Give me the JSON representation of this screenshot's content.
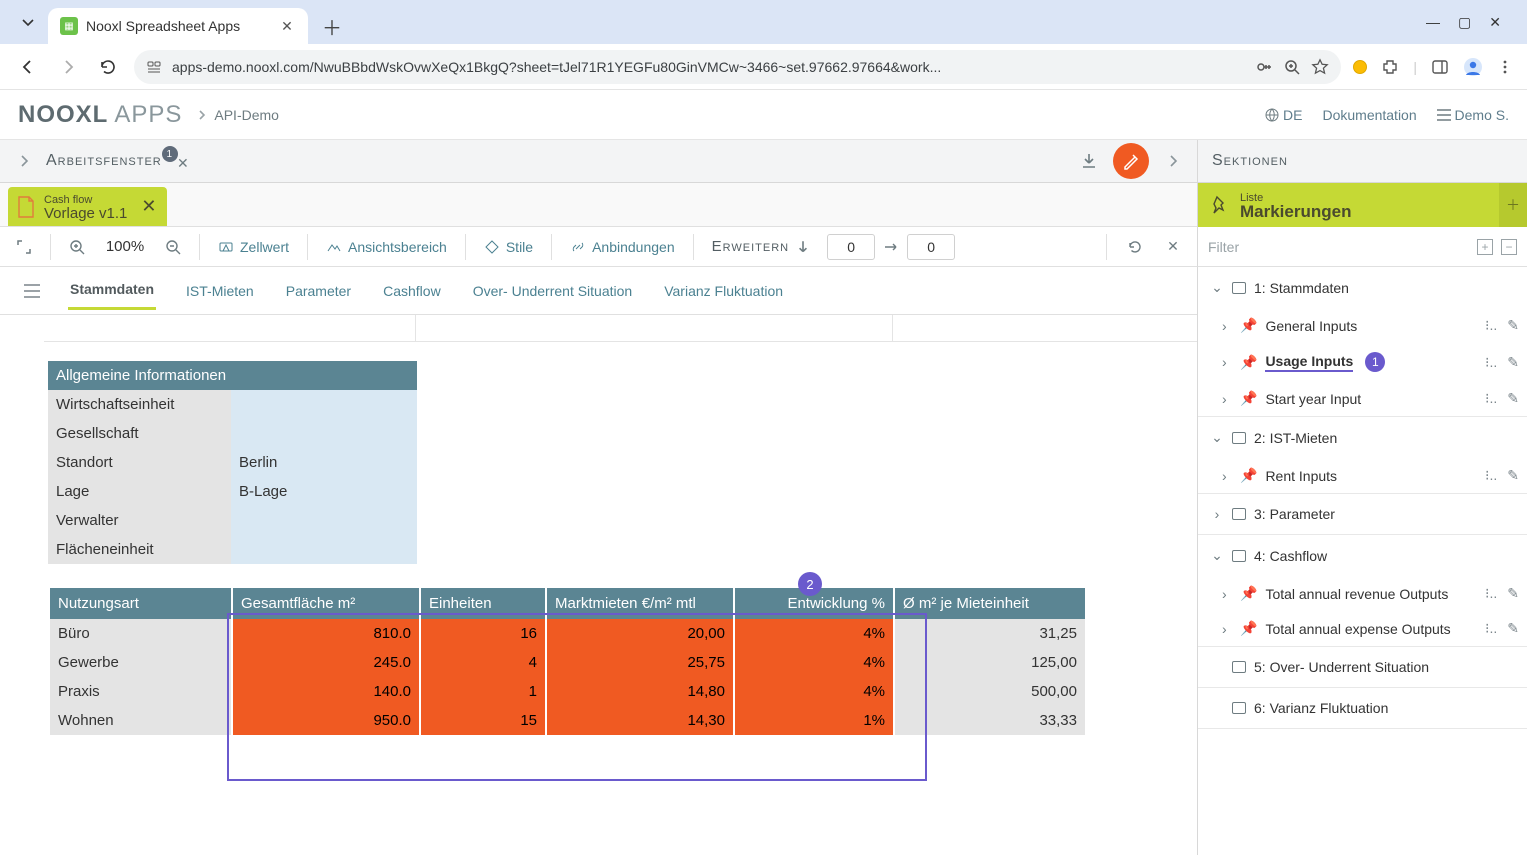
{
  "browser": {
    "tab_title": "Nooxl Spreadsheet Apps",
    "url": "apps-demo.nooxl.com/NwuBBbdWskOvwXeQx1BkgQ?sheet=tJel71R1YEGFu80GinVMCw~3466~set.97662.97664&work..."
  },
  "header": {
    "brand": "NOOXL",
    "brand_sub": "APPS",
    "crumb": "API-Demo",
    "lang": "DE",
    "docs": "Dokumentation",
    "user": "Demo S."
  },
  "toolbar1": {
    "title": "Arbeitsfenster",
    "badge": "1",
    "sektionen": "Sektionen"
  },
  "sheetTab": {
    "category": "Cash flow",
    "name": "Vorlage v1.1"
  },
  "markHeader": {
    "category": "Liste",
    "name": "Markierungen"
  },
  "toolbar2": {
    "zoom": "100%",
    "zellwert": "Zellwert",
    "ansicht": "Ansichtsbereich",
    "stile": "Stile",
    "anbindungen": "Anbindungen",
    "erweitern": "Erweitern",
    "n1": "0",
    "n2": "0",
    "filter": "Filter"
  },
  "sheetNav": {
    "tab1": "Stammdaten",
    "tab2": "IST-Mieten",
    "tab3": "Parameter",
    "tab4": "Cashflow",
    "tab5": "Over- Underrent Situation",
    "tab6": "Varianz Fluktuation"
  },
  "infoTable": {
    "header": "Allgemeine Informationen",
    "r1_l": "Wirtschaftseinheit",
    "r1_v": "",
    "r2_l": "Gesellschaft",
    "r2_v": "",
    "r3_l": "Standort",
    "r3_v": "Berlin",
    "r4_l": "Lage",
    "r4_v": "B-Lage",
    "r5_l": "Verwalter",
    "r5_v": "",
    "r6_l": "Flächeneinheit",
    "r6_v": ""
  },
  "usageTable": {
    "h1": "Nutzungsart",
    "h2": "Gesamtfläche m²",
    "h3": "Einheiten",
    "h4": "Marktmieten €/m² mtl",
    "h5": "Entwicklung %",
    "h6": "Ø m² je Mieteinheit",
    "r1": {
      "name": "Büro",
      "area": "810.0",
      "units": "16",
      "rent": "20,00",
      "dev": "4%",
      "avg": "31,25"
    },
    "r2": {
      "name": "Gewerbe",
      "area": "245.0",
      "units": "4",
      "rent": "25,75",
      "dev": "4%",
      "avg": "125,00"
    },
    "r3": {
      "name": "Praxis",
      "area": "140.0",
      "units": "1",
      "rent": "14,80",
      "dev": "4%",
      "avg": "500,00"
    },
    "r4": {
      "name": "Wohnen",
      "area": "950.0",
      "units": "15",
      "rent": "14,30",
      "dev": "1%",
      "avg": "33,33"
    },
    "badge2": "2"
  },
  "sections": {
    "s1": "1: Stammdaten",
    "s1a": "General Inputs",
    "s1b": "Usage Inputs",
    "s1b_badge": "1",
    "s1c": "Start year Input",
    "s2": "2: IST-Mieten",
    "s2a": "Rent Inputs",
    "s3": "3: Parameter",
    "s4": "4: Cashflow",
    "s4a": "Total annual revenue Outputs",
    "s4b": "Total annual expense Outputs",
    "s5": "5: Over- Underrent Situation",
    "s6": "6: Varianz Fluktuation"
  }
}
